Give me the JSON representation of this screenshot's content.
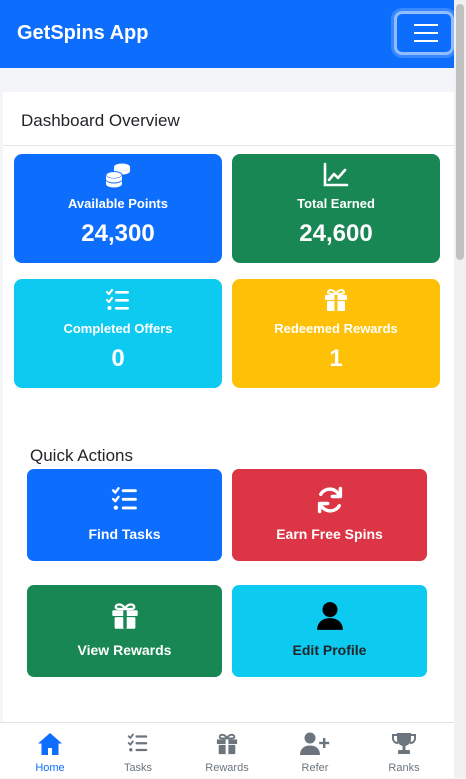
{
  "app": {
    "brand": "GetSpins App",
    "colors": {
      "primary": "#0d6efd",
      "success": "#198754",
      "info": "#0dcaf0",
      "warning": "#ffc107",
      "danger": "#dc3545"
    }
  },
  "dashboard": {
    "title": "Dashboard Overview",
    "stats": [
      {
        "label": "Available Points",
        "value": "24,300",
        "icon": "coins-icon"
      },
      {
        "label": "Total Earned",
        "value": "24,600",
        "icon": "chart-line-icon"
      },
      {
        "label": "Completed Offers",
        "value": "0",
        "icon": "task-list-icon"
      },
      {
        "label": "Redeemed Rewards",
        "value": "1",
        "icon": "gift-icon"
      }
    ]
  },
  "quick_actions": {
    "title": "Quick Actions",
    "items": [
      {
        "label": "Find Tasks",
        "icon": "task-list-icon"
      },
      {
        "label": "Earn Free Spins",
        "icon": "refresh-icon"
      },
      {
        "label": "View Rewards",
        "icon": "gift-icon"
      },
      {
        "label": "Edit Profile",
        "icon": "user-icon"
      }
    ]
  },
  "bottom_nav": {
    "active": "Home",
    "items": [
      {
        "label": "Home",
        "icon": "home-icon"
      },
      {
        "label": "Tasks",
        "icon": "task-list-icon"
      },
      {
        "label": "Rewards",
        "icon": "gift-icon"
      },
      {
        "label": "Refer",
        "icon": "user-plus-icon"
      },
      {
        "label": "Ranks",
        "icon": "trophy-icon"
      }
    ]
  }
}
